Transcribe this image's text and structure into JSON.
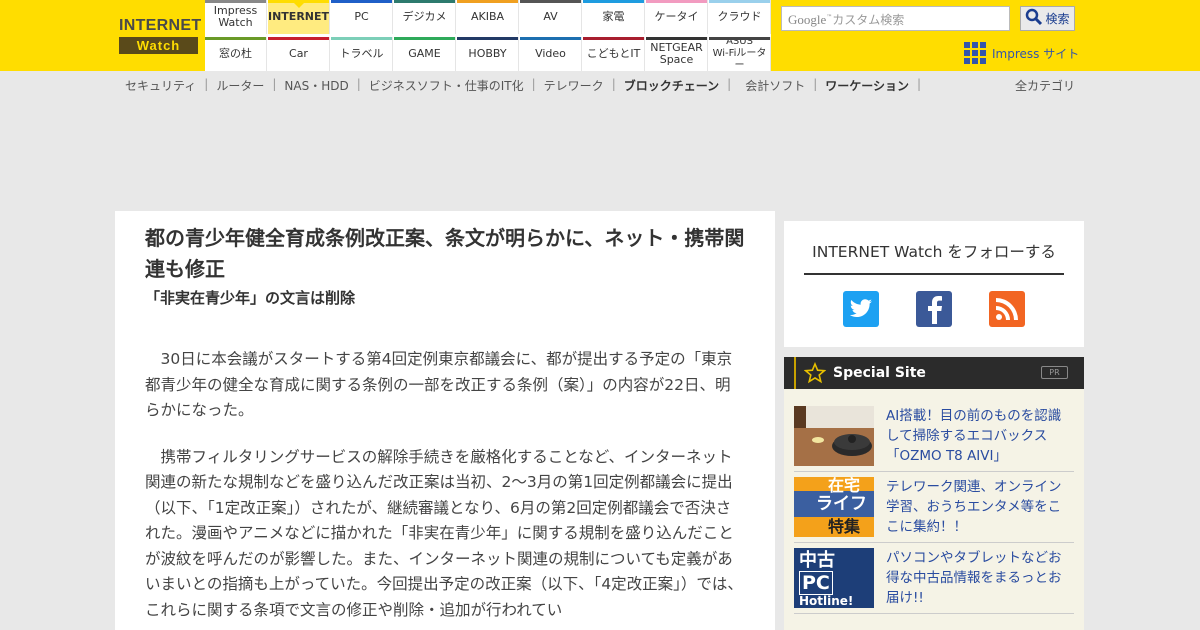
{
  "logo": {
    "line1": "INTERNET",
    "line2": "Watch"
  },
  "sites_top": [
    {
      "label": "Impress\nWatch",
      "color": "#888888",
      "active": false
    },
    {
      "label": "INTERNET",
      "color": "#ffdd00",
      "active": true
    },
    {
      "label": "PC",
      "color": "#1f5fc8",
      "active": false
    },
    {
      "label": "デジカメ",
      "color": "#2d7a6e",
      "active": false
    },
    {
      "label": "AKIBA",
      "color": "#f0a020",
      "active": false
    },
    {
      "label": "AV",
      "color": "#555555",
      "active": false
    },
    {
      "label": "家電",
      "color": "#1e9ce0",
      "active": false
    },
    {
      "label": "ケータイ",
      "color": "#f29bc0",
      "active": false
    },
    {
      "label": "クラウド",
      "color": "#9ad0ec",
      "active": false
    }
  ],
  "sites_bottom": [
    {
      "label": "窓の杜",
      "color": "#6a9a28"
    },
    {
      "label": "Car",
      "color": "#c81e2e"
    },
    {
      "label": "トラベル",
      "color": "#7ccfb8"
    },
    {
      "label": "GAME",
      "color": "#2eaa5a"
    },
    {
      "label": "HOBBY",
      "color": "#223a66"
    },
    {
      "label": "Video",
      "color": "#1d6fb0"
    },
    {
      "label": "こどもとIT",
      "color": "#a81e2e"
    },
    {
      "label": "NETGEAR\nSpace",
      "color": "#333333"
    },
    {
      "label": "ASUS\nWi-Fiルーター",
      "color": "#444444"
    }
  ],
  "search": {
    "google": "Google",
    "placeholder": "カスタム検索",
    "button": "検索"
  },
  "impress_site": "Impress サイト",
  "catnav": [
    {
      "label": "セキュリティ",
      "bold": false
    },
    {
      "label": "ルーター",
      "bold": false
    },
    {
      "label": "NAS・HDD",
      "bold": false
    },
    {
      "label": "ビジネスソフト・仕事のIT化",
      "bold": false
    },
    {
      "label": "テレワーク",
      "bold": false
    },
    {
      "label": "ブロックチェーン",
      "bold": true
    },
    {
      "label": "会計ソフト",
      "bold": false
    },
    {
      "label": "ワーケーション",
      "bold": true
    }
  ],
  "catnav_sep": "|",
  "all_categories": "全カテゴリ",
  "article": {
    "title": "都の青少年健全育成条例改正案、条文が明らかに、ネット・携帯関連も修正",
    "subtitle": "「非実在青少年」の文言は削除",
    "paragraphs": [
      "30日に本会議がスタートする第4回定例東京都議会に、都が提出する予定の「東京都青少年の健全な育成に関する条例の一部を改正する条例（案）」の内容が22日、明らかになった。",
      "携帯フィルタリングサービスの解除手続きを厳格化することなど、インターネット関連の新たな規制などを盛り込んだ改正案は当初、2～3月の第1回定例都議会に提出（以下、「1定改正案」）されたが、継続審議となり、6月の第2回定例都議会で否決された。漫画やアニメなどに描かれた「非実在青少年」に関する規制を盛り込んだことが波紋を呼んだのが影響した。また、インターネット関連の規制についても定義があいまいとの指摘も上がっていた。今回提出予定の改正案（以下、「4定改正案」）では、これらに関する条項で文言の修正や削除・追加が行われてい"
    ]
  },
  "follow": {
    "title": "INTERNET Watch をフォローする",
    "icons": [
      "twitter-icon",
      "facebook-icon",
      "rss-icon"
    ]
  },
  "special": {
    "title": "Special Site",
    "pr": "PR",
    "items": [
      {
        "text": "AI搭載！目の前のものを認識して掃除するエコバックス「OZMO T8 AIVI」",
        "thumb": "robot-vacuum"
      },
      {
        "text": "テレワーク関連、オンライン学習、おうちエンタメ等をここに集約！！",
        "thumb_lines": [
          "在宅",
          "ライフ",
          "特集"
        ]
      },
      {
        "text": "パソコンやタブレットなどお得な中古品情報をまるっとお届け!!",
        "thumb_lines": [
          "中古",
          "PC",
          "Hotline!"
        ]
      }
    ]
  }
}
